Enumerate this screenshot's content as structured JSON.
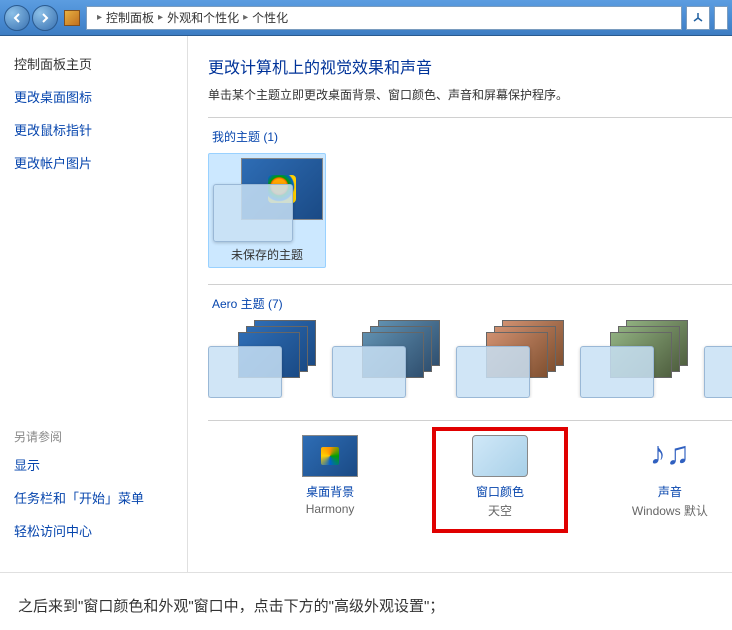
{
  "breadcrumb": {
    "seg1": "控制面板",
    "seg2": "外观和个性化",
    "seg3": "个性化"
  },
  "sidebar": {
    "title": "控制面板主页",
    "links": [
      "更改桌面图标",
      "更改鼠标指针",
      "更改帐户图片"
    ],
    "see_also_label": "另请参阅",
    "see_also": [
      "显示",
      "任务栏和「开始」菜单",
      "轻松访问中心"
    ]
  },
  "page": {
    "title": "更改计算机上的视觉效果和声音",
    "subtitle": "单击某个主题立即更改桌面背景、窗口颜色、声音和屏幕保护程序。"
  },
  "sections": {
    "my_themes": "我的主题 (1)",
    "aero_themes": "Aero 主题 (7)"
  },
  "my_theme_unsaved": "未保存的主题",
  "footer": {
    "bg": {
      "label": "桌面背景",
      "value": "Harmony"
    },
    "color": {
      "label": "窗口颜色",
      "value": "天空"
    },
    "sound": {
      "label": "声音",
      "value": "Windows 默认"
    }
  },
  "caption": "之后来到\"窗口颜色和外观\"窗口中，点击下方的\"高级外观设置\"；"
}
